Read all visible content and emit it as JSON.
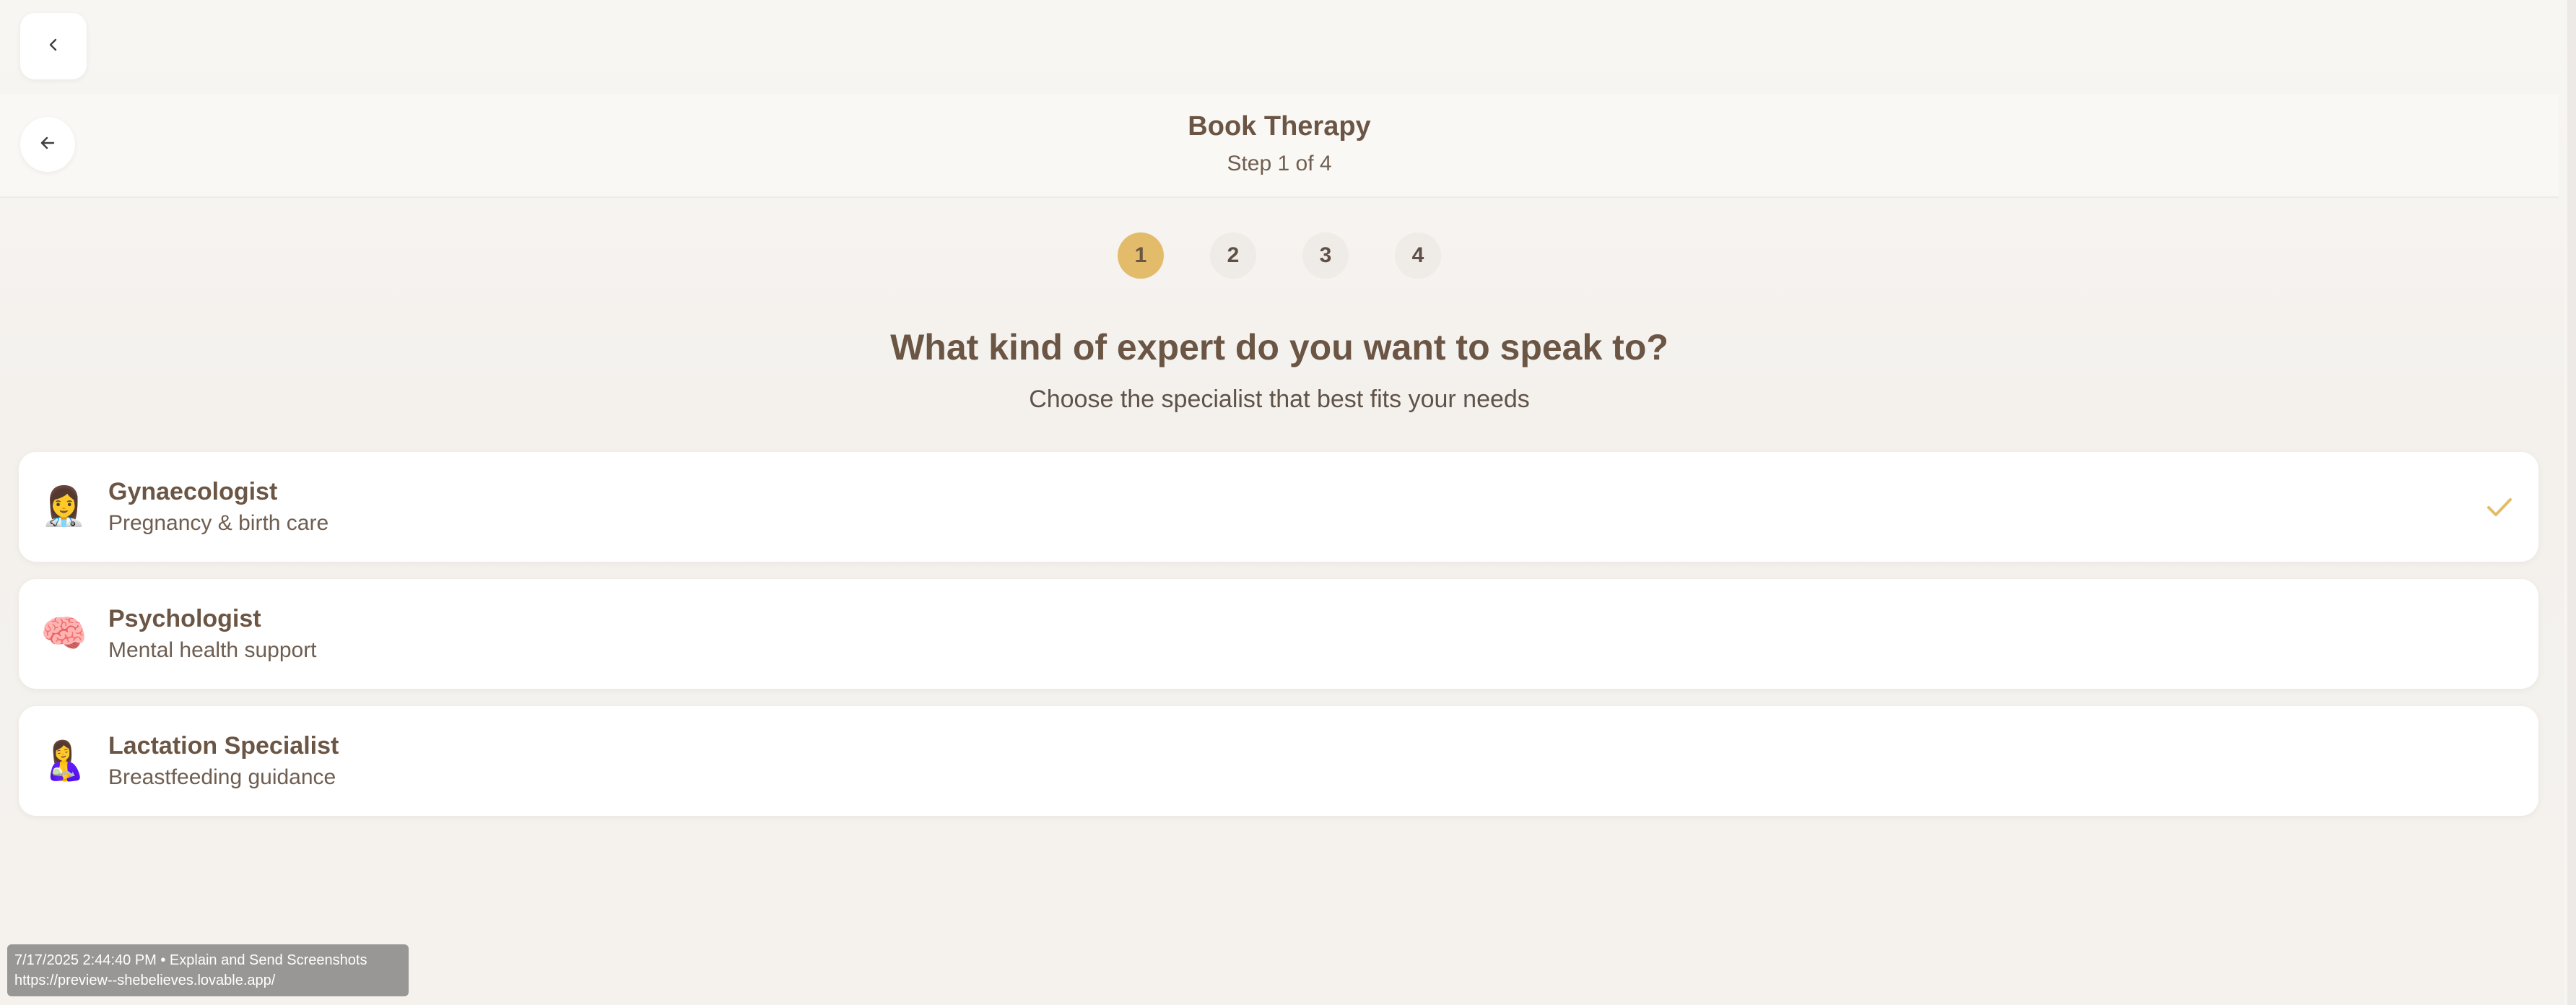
{
  "header": {
    "title": "Book Therapy",
    "step_text": "Step 1 of 4"
  },
  "stepper": {
    "steps": [
      "1",
      "2",
      "3",
      "4"
    ],
    "active_step": "1",
    "active_color": "#e2bc6a"
  },
  "main": {
    "question": "What kind of expert do you want to speak to?",
    "subtitle": "Choose the specialist that best fits your needs"
  },
  "options": [
    {
      "icon": "woman-health-worker-icon",
      "emoji": "👩‍⚕️",
      "title": "Gynaecologist",
      "description": "Pregnancy & birth care",
      "selected": true
    },
    {
      "icon": "brain-icon",
      "emoji": "🧠",
      "title": "Psychologist",
      "description": "Mental health support",
      "selected": false
    },
    {
      "icon": "breastfeeding-icon",
      "emoji": "🤱",
      "title": "Lactation Specialist",
      "description": "Breastfeeding guidance",
      "selected": false
    }
  ],
  "overlay": {
    "line1": "7/17/2025 2:44:40 PM • Explain and Send Screenshots",
    "line2": "https://preview--shebelieves.lovable.app/"
  },
  "colors": {
    "accent": "#e2bc6a",
    "text_brown": "#6b5544",
    "background": "#f6f3ef"
  }
}
